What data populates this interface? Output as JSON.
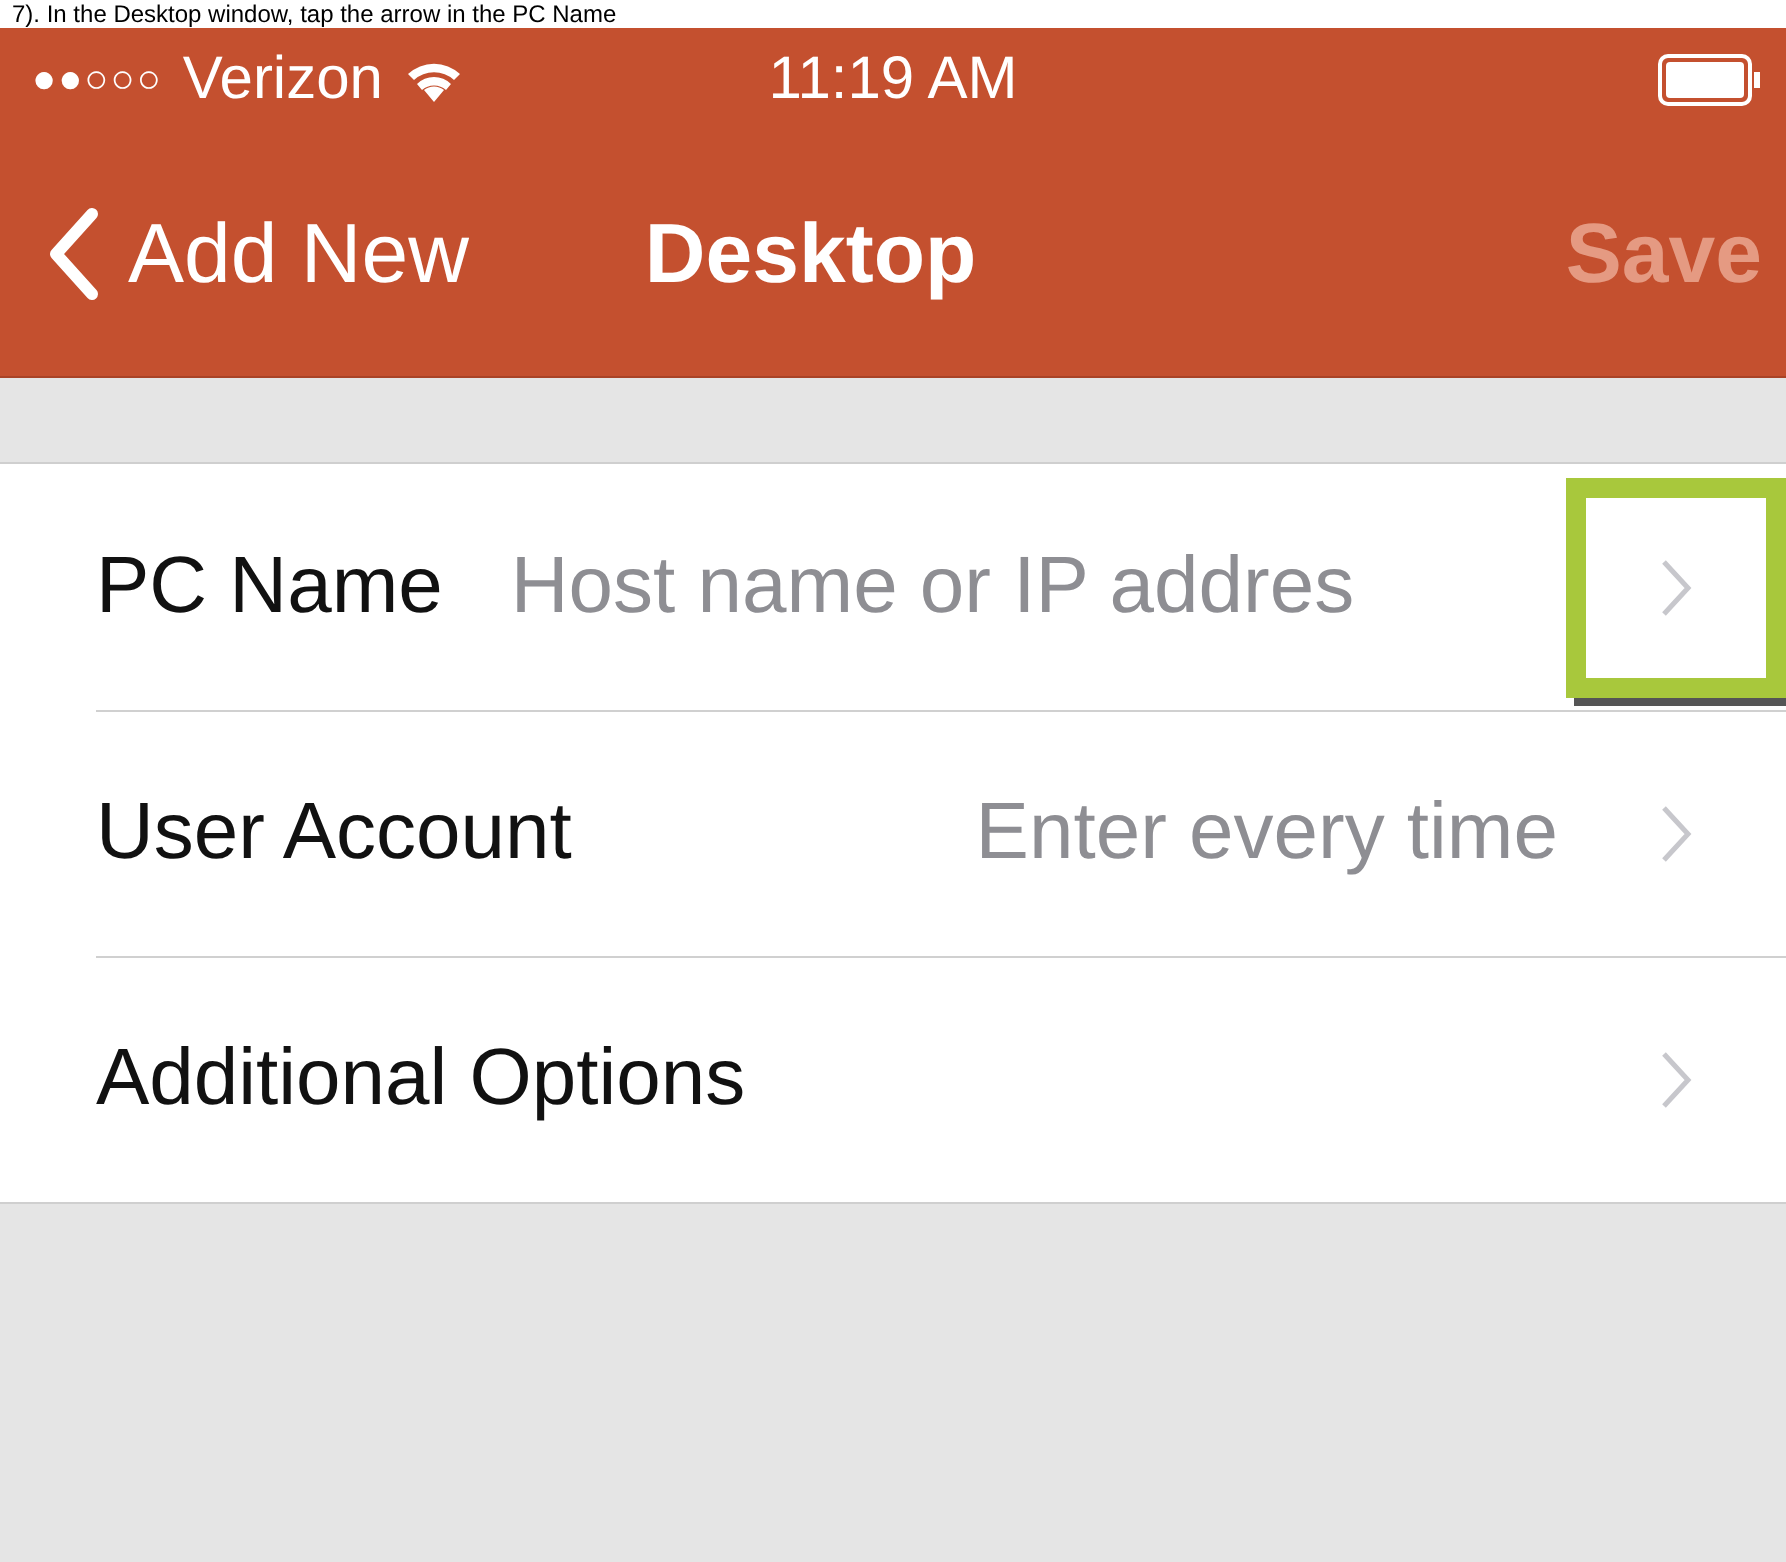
{
  "caption": "7). In the Desktop window, tap the arrow in the PC Name",
  "status_bar": {
    "carrier": "Verizon",
    "signal_dots": "●●○○○",
    "time": "11:19 AM"
  },
  "nav_bar": {
    "back": "Add New",
    "title": "Desktop",
    "save": {
      "label": "Save",
      "disabled": true
    }
  },
  "rows": [
    {
      "kind": "field",
      "label": "PC Name",
      "placeholder": "Host name or IP addres",
      "highlighted": true
    },
    {
      "kind": "value",
      "label": "User Account",
      "value": "Enter every time",
      "highlighted": false
    },
    {
      "kind": "plain",
      "label": "Additional Options",
      "highlighted": false
    }
  ]
}
